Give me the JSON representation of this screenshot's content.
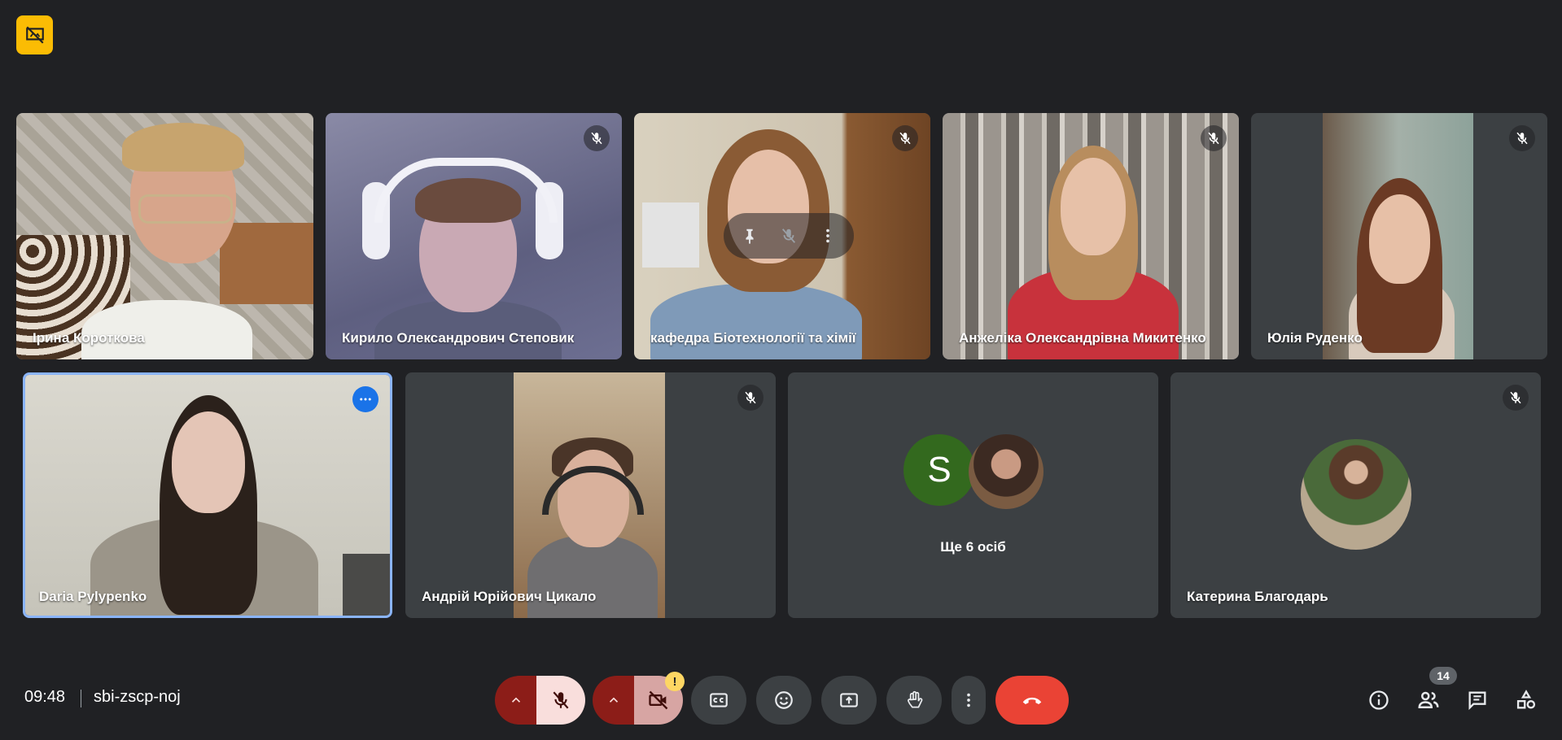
{
  "participants": [
    {
      "name": "Ірина Короткова",
      "muted": false
    },
    {
      "name": "Кирило Олександрович Степовик",
      "muted": true
    },
    {
      "name": "кафедра Біотехнології та хімії",
      "muted": true
    },
    {
      "name": "Анжеліка Олександрівна Микитенко",
      "muted": true
    },
    {
      "name": "Юлія Руденко",
      "muted": true
    },
    {
      "name": "Daria Pylypenko",
      "muted": false,
      "active": true
    },
    {
      "name": "Андрій Юрійович Цикало",
      "muted": true
    },
    {
      "name": "Катерина Благодарь",
      "muted": true
    }
  ],
  "more_people": {
    "initial": "S",
    "label": "Ще 6 осіб"
  },
  "meeting": {
    "time": "09:48",
    "code": "sbi-zscp-noj"
  },
  "warning_badge": "!",
  "people_count": "14",
  "colors": {
    "background": "#202124",
    "tile": "#3c4043",
    "mic_off_dark": "#8c1d18",
    "mic_off_light": "#f9dedc",
    "hangup": "#ea4335",
    "active_border": "#8ab4f8",
    "presentation_badge": "#fbbc04"
  },
  "icons": [
    "presentation-off-icon",
    "mic-off-icon",
    "pin-icon",
    "more-vert-icon",
    "more-horiz-icon",
    "chevron-up-icon",
    "camera-off-icon",
    "captions-icon",
    "emoji-icon",
    "present-icon",
    "raise-hand-icon",
    "call-end-icon",
    "info-icon",
    "people-icon",
    "chat-icon",
    "activities-icon"
  ]
}
